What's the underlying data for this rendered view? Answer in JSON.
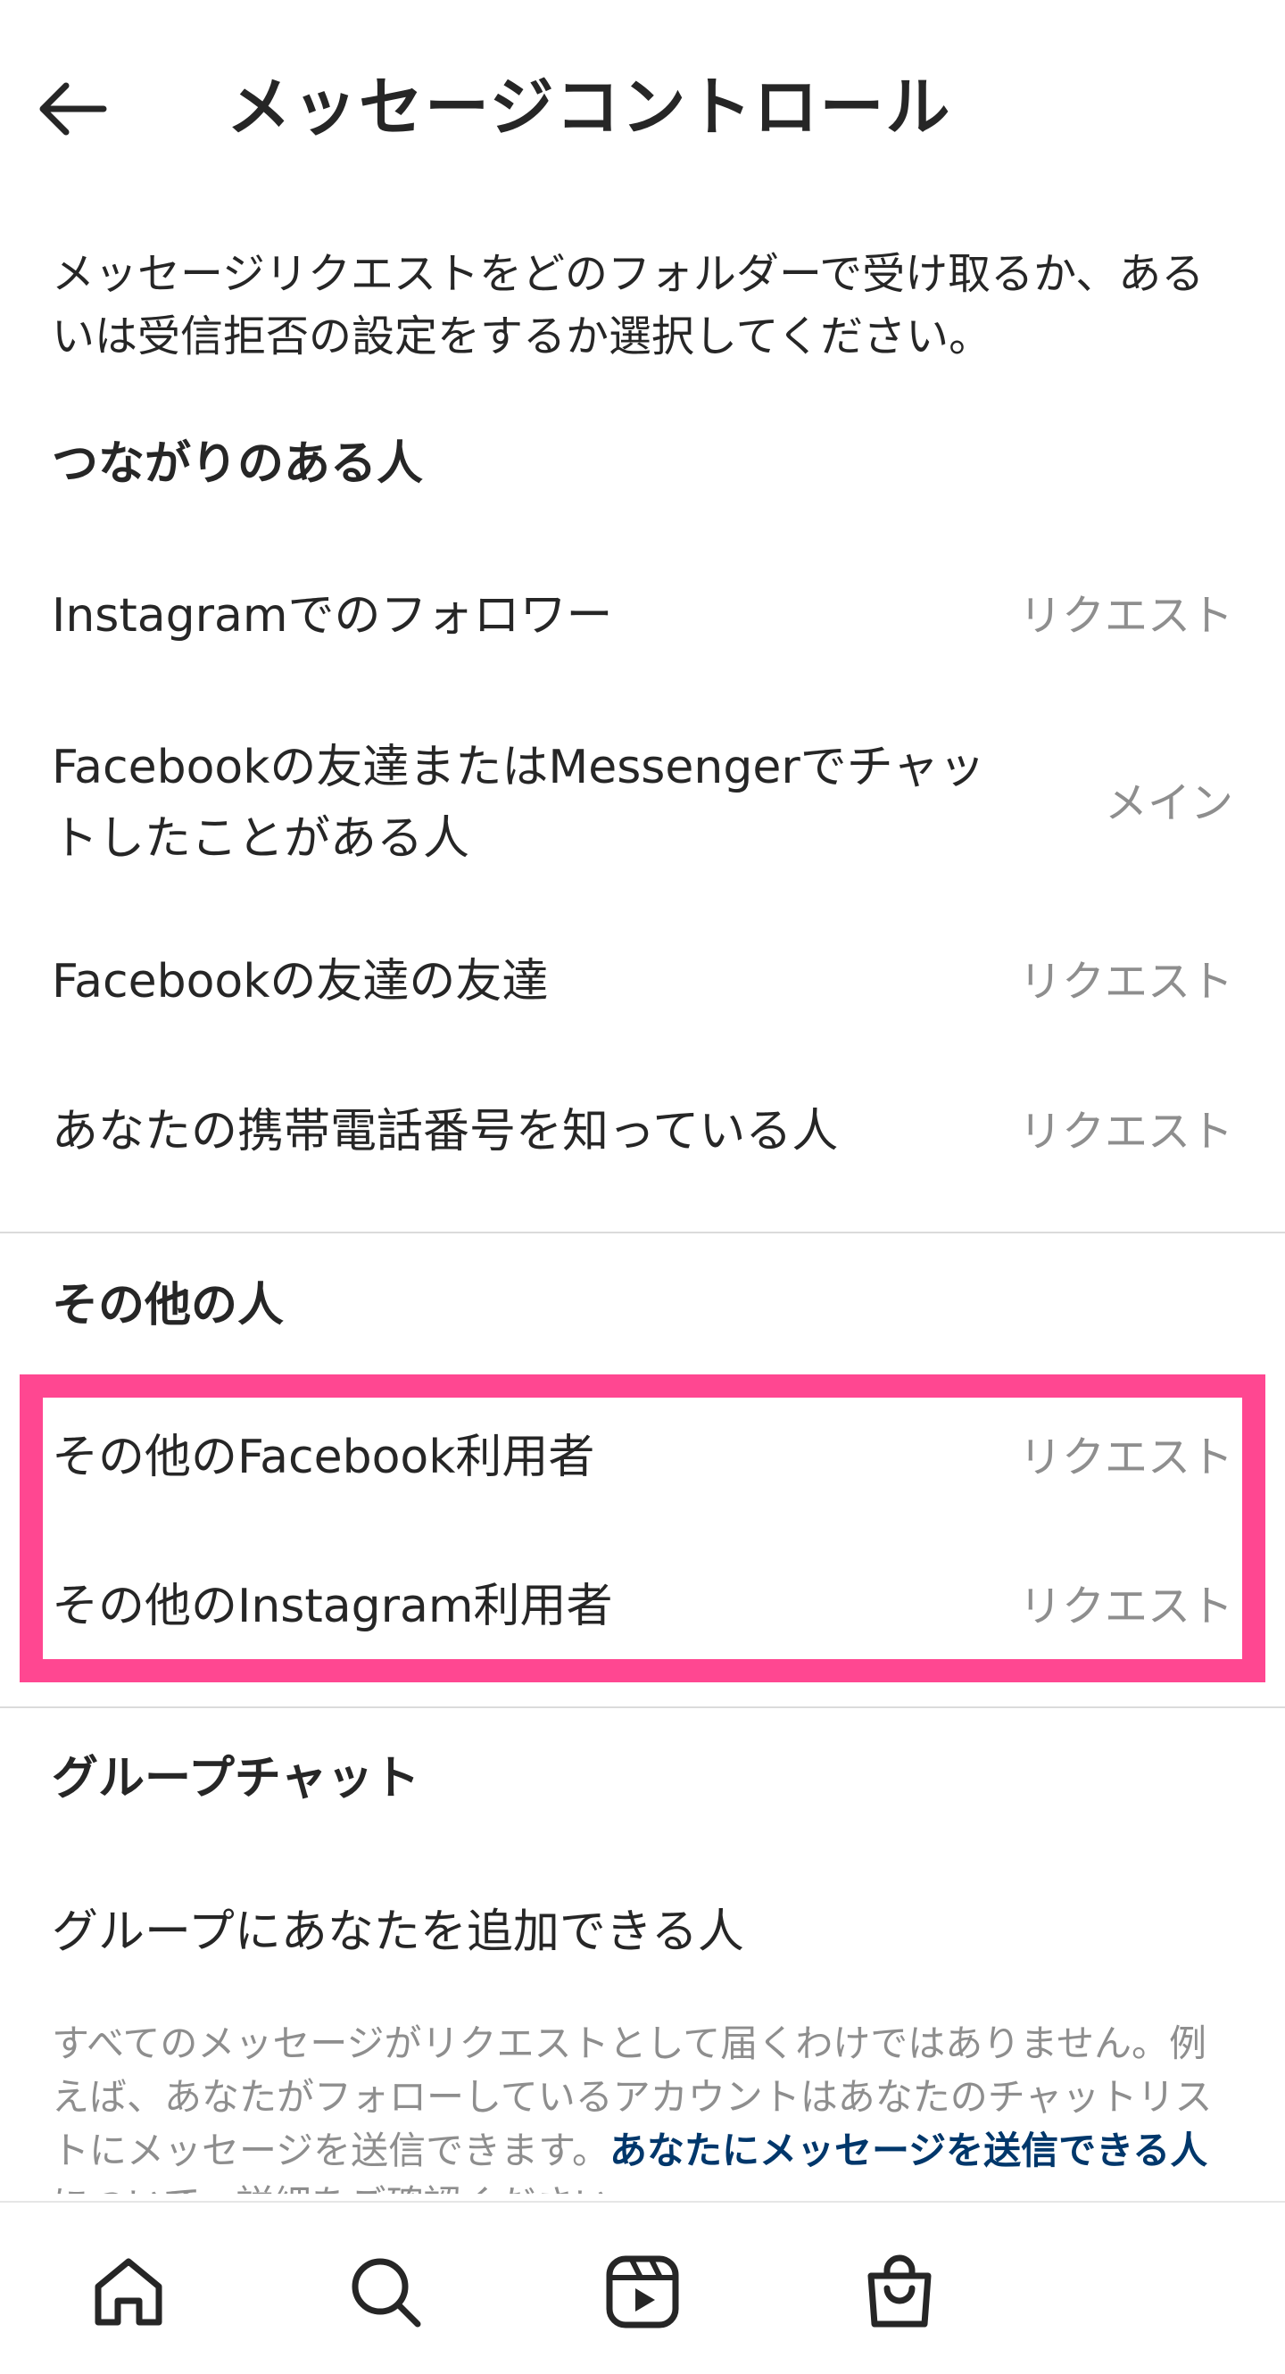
{
  "header": {
    "title": "メッセージコントロール",
    "back_icon": "arrow-left-icon"
  },
  "description": "メッセージリクエストをどのフォルダーで受け取るか、あるいは受信拒否の設定をするか選択してください。",
  "sections": {
    "connected": {
      "title": "つながりのある人",
      "rows": [
        {
          "label": "Instagramでのフォロワー",
          "value": "リクエスト"
        },
        {
          "label_line1": "Facebookの友達またはMessengerでチャッ",
          "label_line2": "トしたことがある人",
          "value": "メイン"
        },
        {
          "label": "Facebookの友達の友達",
          "value": "リクエスト"
        },
        {
          "label": "あなたの携帯電話番号を知っている人",
          "value": "リクエスト"
        }
      ]
    },
    "others": {
      "title": "その他の人",
      "rows": [
        {
          "label": "その他のFacebook利用者",
          "value": "リクエスト"
        },
        {
          "label": "その他のInstagram利用者",
          "value": "リクエスト"
        }
      ]
    },
    "group": {
      "title": "グループチャット",
      "rows": [
        {
          "label": "グループにあなたを追加できる人"
        }
      ]
    }
  },
  "footnote": {
    "text": "すべてのメッセージがリクエストとして届くわけではありません。例えば、あなたがフォローしているアカウントはあなたのチャットリストにメッセージを送信できます。",
    "link": "あなたにメッセージを送信できる人",
    "text_after": "について、詳細をご確認ください。"
  },
  "highlight_color": "#ff4791",
  "bottom_nav": [
    {
      "icon": "home-icon"
    },
    {
      "icon": "search-icon"
    },
    {
      "icon": "reels-icon"
    },
    {
      "icon": "shop-icon"
    }
  ]
}
